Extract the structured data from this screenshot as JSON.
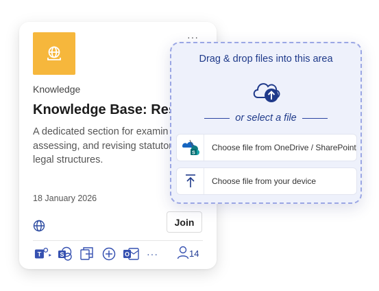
{
  "card": {
    "category": "Knowledge",
    "title": "Knowledge Base: Reso",
    "description": "A dedicated section for examin assessing, and revising statutor and legal structures.",
    "date": "18 January 2026",
    "join_label": "Join",
    "tile_color": "#f6b73c",
    "apps": [
      "teams-icon",
      "sharepoint-icon",
      "files-icon",
      "loop-icon",
      "outlook-icon"
    ],
    "more_label": "···",
    "people_count": "14"
  },
  "upload": {
    "title": "Drag & drop files into this area",
    "or_label": "or select a file",
    "options": [
      {
        "label": "Choose file from OneDrive / SharePoint",
        "icon": "onedrive-sharepoint-icon"
      },
      {
        "label": "Choose file from your device",
        "icon": "upload-arrow-icon"
      }
    ],
    "accent_color": "#1f3a8a"
  }
}
